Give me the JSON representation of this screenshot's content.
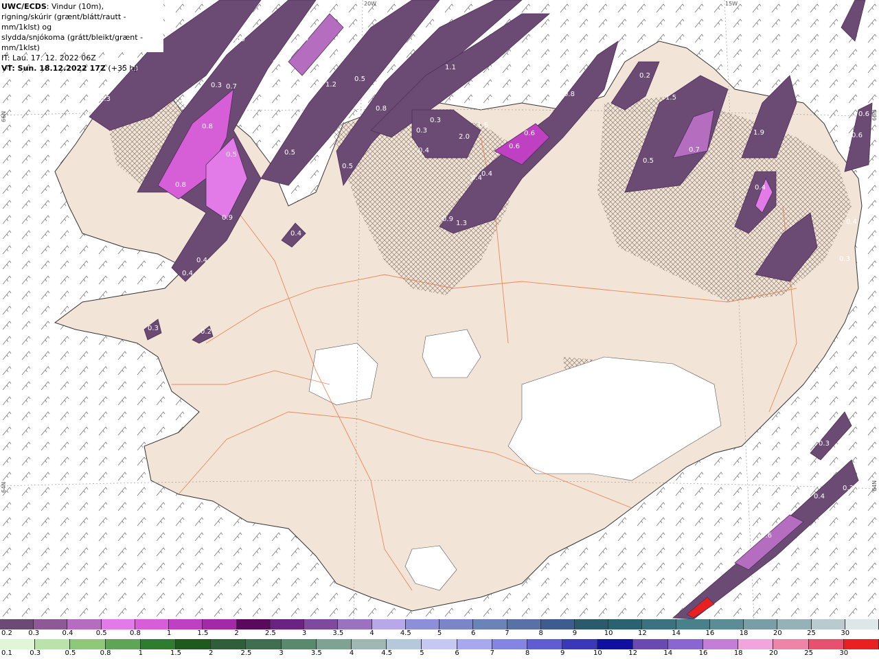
{
  "header": {
    "line1_bold": "UWC/ECDS",
    "line1_rest": ": Vindur (10m),",
    "line2": "rigning/skúrir (grænt/blátt/rautt - mm/1klst) og",
    "line3": "slydda/snjókoma (grátt/bleikt/grænt - mm/1klst)",
    "line4": "IT: Lau. 17. 12. 2022 06Z",
    "line5_bold": "VT: Sun. 18.12.2022 17Z",
    "line5_rest": " (+35 h)"
  },
  "graticule": {
    "lon_20": "20W",
    "lon_15": "15W",
    "lat_66_left": "66N",
    "lat_66_right": "66N",
    "lat_64_left": "64N",
    "lat_64_right": "64N"
  },
  "precip_labels": [
    "0.3",
    "0.5",
    "0.3",
    "0.3",
    "0.3",
    "0.7",
    "0.6",
    "0.5",
    "0.3",
    "0.7",
    "0.2",
    "1.2",
    "0.8",
    "0.5",
    "0.8",
    "0.5",
    "0.5",
    "0.9",
    "0.4",
    "0.4",
    "0.4",
    "0.3",
    "0.2",
    "0.8",
    "1.1",
    "0.3",
    "0.3",
    "0.2",
    "0.3",
    "0.4",
    "0.3",
    "2.0",
    "1.6",
    "0.6",
    "0.6",
    "0.4",
    "0.4",
    "0.9",
    "1.3",
    "0.8",
    "0.2",
    "1.5",
    "0.7",
    "0.5",
    "1.9",
    "0.4",
    "0.6",
    "0.6",
    "0.4",
    "0.3",
    "0.3",
    "0.3",
    "0.4",
    "0.3",
    "0.6"
  ],
  "legend_snow": {
    "labels": [
      "0.2",
      "0.3",
      "0.4",
      "0.5",
      "0.8",
      "1",
      "1.5",
      "2",
      "2.5",
      "3",
      "3.5",
      "4",
      "4.5",
      "5",
      "6",
      "7",
      "8",
      "9",
      "10",
      "12",
      "14",
      "16",
      "18",
      "20",
      "25",
      "30"
    ],
    "colors": [
      "#6b4a74",
      "#8e5a96",
      "#b56dc0",
      "#e27ae8",
      "#d65fd8",
      "#c040c3",
      "#a329a6",
      "#5a0a5c",
      "#6a2380",
      "#7f4a9e",
      "#9a72bf",
      "#b8a8e8",
      "#8d90d8",
      "#7b86c7",
      "#6a84b8",
      "#5872a6",
      "#3f5c8f",
      "#2d5a6a",
      "#2c6170",
      "#3c7280",
      "#4a7f8c",
      "#5e8c96",
      "#799ea6",
      "#94b2b8",
      "#b9cbce",
      "#dde6e8"
    ]
  },
  "legend_rain": {
    "labels": [
      "0.1",
      "0.3",
      "0.5",
      "0.8",
      "1",
      "1.5",
      "2",
      "2.5",
      "3",
      "3.5",
      "4",
      "4.5",
      "5",
      "6",
      "7",
      "8",
      "9",
      "10",
      "12",
      "14",
      "16",
      "18",
      "20",
      "25",
      "30"
    ],
    "colors": [
      "#dff7d6",
      "#b9e3a8",
      "#8ec97a",
      "#5fa556",
      "#2e7d2e",
      "#1d5a1d",
      "#2e5e3a",
      "#3f6f50",
      "#5a8a6e",
      "#7ea392",
      "#9fb8b4",
      "#b6c8dc",
      "#c6c8f4",
      "#a8a8ee",
      "#8484e2",
      "#5e5ed0",
      "#3838b8",
      "#1010a0",
      "#6a4ab0",
      "#8a66d0",
      "#c47ed8",
      "#f2a4dc",
      "#ee84a8",
      "#e85070",
      "#e82020"
    ]
  }
}
